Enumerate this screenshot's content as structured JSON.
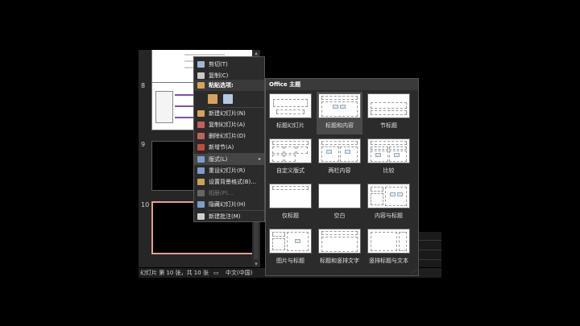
{
  "thumbnail_pane": {
    "slides": [
      {
        "number": ""
      },
      {
        "number": "8",
        "lines": [
          "基础概念",
          "重点",
          "标题与内容",
          "标题"
        ]
      },
      {
        "number": "9"
      },
      {
        "number": "10"
      }
    ]
  },
  "context_menu": {
    "items": [
      {
        "label": "剪切(T)",
        "icon": "scissors-icon",
        "color": "#9fb6d8"
      },
      {
        "label": "复制(C)",
        "icon": "copy-icon",
        "color": "#c9c9c9"
      },
      {
        "label": "新建幻灯片(N)",
        "icon": "new-slide-icon",
        "color": "#d7a35a"
      },
      {
        "label": "复制幻灯片(A)",
        "icon": "duplicate-slide-icon",
        "color": "#c45f5f"
      },
      {
        "label": "删除幻灯片(D)",
        "icon": "delete-slide-icon",
        "color": "#c45f5f"
      },
      {
        "label": "新增节(A)",
        "icon": "add-section-icon",
        "color": "#c64a3a"
      },
      {
        "label": "版式(L)",
        "icon": "layout-icon",
        "color": "#7f9ccb",
        "highlighted": true,
        "submenu": "▸"
      },
      {
        "label": "重设幻灯片(R)",
        "icon": "reset-slide-icon",
        "color": "#7f9ccb"
      },
      {
        "label": "设置背景格式(B)...",
        "icon": "format-background-icon",
        "color": "#c9a35a"
      },
      {
        "label": "相册(P)...",
        "icon": "photo-album-icon",
        "color": "#666666",
        "disabled": true
      },
      {
        "label": "隐藏幻灯片(H)",
        "icon": "hide-slide-icon",
        "color": "#7f9ccb"
      },
      {
        "label": "新建批注(M)",
        "icon": "new-comment-icon",
        "color": "#cfcfcf"
      }
    ],
    "paste_header": "粘贴选项:",
    "paste_buttons": [
      {
        "icon": "paste-keep-theme-icon",
        "color": "#d7a35a"
      },
      {
        "icon": "paste-picture-icon",
        "color": "#b5c9e0"
      }
    ]
  },
  "layout_gallery": {
    "header": "Office 主题",
    "selected_index": 1,
    "layouts": [
      {
        "label": "标题幻灯片",
        "kind": "title"
      },
      {
        "label": "标题和内容",
        "kind": "title-content"
      },
      {
        "label": "节标题",
        "kind": "section"
      },
      {
        "label": "自定义版式",
        "kind": "custom"
      },
      {
        "label": "两栏内容",
        "kind": "two-content"
      },
      {
        "label": "比较",
        "kind": "comparison"
      },
      {
        "label": "仅标题",
        "kind": "title-only"
      },
      {
        "label": "空白",
        "kind": "blank"
      },
      {
        "label": "内容与标题",
        "kind": "content-caption"
      },
      {
        "label": "图片与标题",
        "kind": "picture-caption"
      },
      {
        "label": "标题和竖排文字",
        "kind": "title-vertical"
      },
      {
        "label": "竖排标题与文本",
        "kind": "vertical-title"
      }
    ]
  },
  "status_bar": {
    "slide_info": "幻灯片 第 10 张，共 10 张",
    "language": "中文(中国)"
  }
}
